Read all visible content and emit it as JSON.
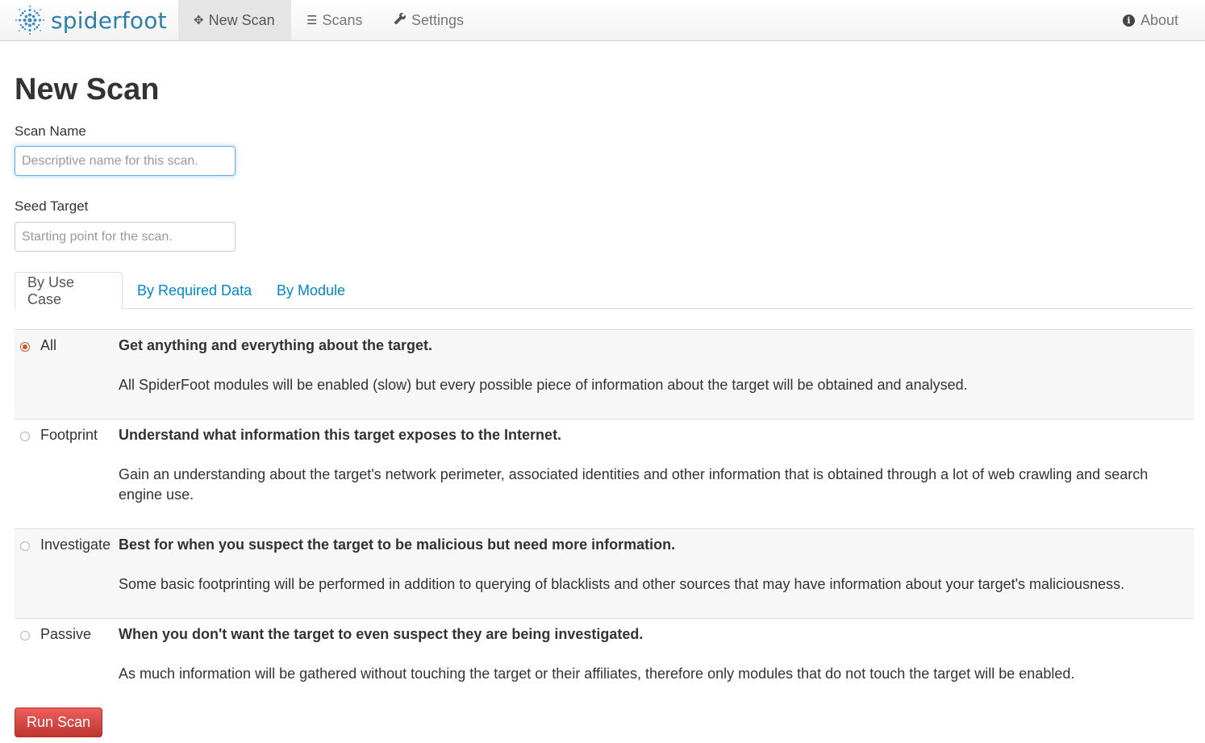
{
  "brand": {
    "name": "spiderfoot",
    "logo_icon": "spiderfoot-logo-icon",
    "color": "#2f7fa8"
  },
  "nav": {
    "new_scan": {
      "label": "New Scan",
      "icon": "move-icon"
    },
    "scans": {
      "label": "Scans",
      "icon": "list-icon"
    },
    "settings": {
      "label": "Settings",
      "icon": "wrench-icon"
    },
    "about": {
      "label": "About",
      "icon": "info-icon"
    }
  },
  "page": {
    "title": "New Scan"
  },
  "form": {
    "scan_name": {
      "label": "Scan Name",
      "placeholder": "Descriptive name for this scan.",
      "value": ""
    },
    "seed_target": {
      "label": "Seed Target",
      "placeholder": "Starting point for the scan.",
      "value": ""
    }
  },
  "tabs": [
    {
      "label": "By Use Case",
      "active": true
    },
    {
      "label": "By Required Data",
      "active": false
    },
    {
      "label": "By Module",
      "active": false
    }
  ],
  "use_cases": [
    {
      "name": "All",
      "checked": true,
      "title": "Get anything and everything about the target.",
      "description": "All SpiderFoot modules will be enabled (slow) but every possible piece of information about the target will be obtained and analysed."
    },
    {
      "name": "Footprint",
      "checked": false,
      "title": "Understand what information this target exposes to the Internet.",
      "description": "Gain an understanding about the target's network perimeter, associated identities and other information that is obtained through a lot of web crawling and search engine use."
    },
    {
      "name": "Investigate",
      "checked": false,
      "title": "Best for when you suspect the target to be malicious but need more information.",
      "description": "Some basic footprinting will be performed in addition to querying of blacklists and other sources that may have information about your target's maliciousness."
    },
    {
      "name": "Passive",
      "checked": false,
      "title": "When you don't want the target to even suspect they are being investigated.",
      "description": "As much information will be gathered without touching the target or their affiliates, therefore only modules that do not touch the target will be enabled."
    }
  ],
  "actions": {
    "run_scan": "Run Scan"
  },
  "colors": {
    "link": "#0088cc",
    "danger": "#da4f49",
    "radio_checked": "#c9572f"
  }
}
